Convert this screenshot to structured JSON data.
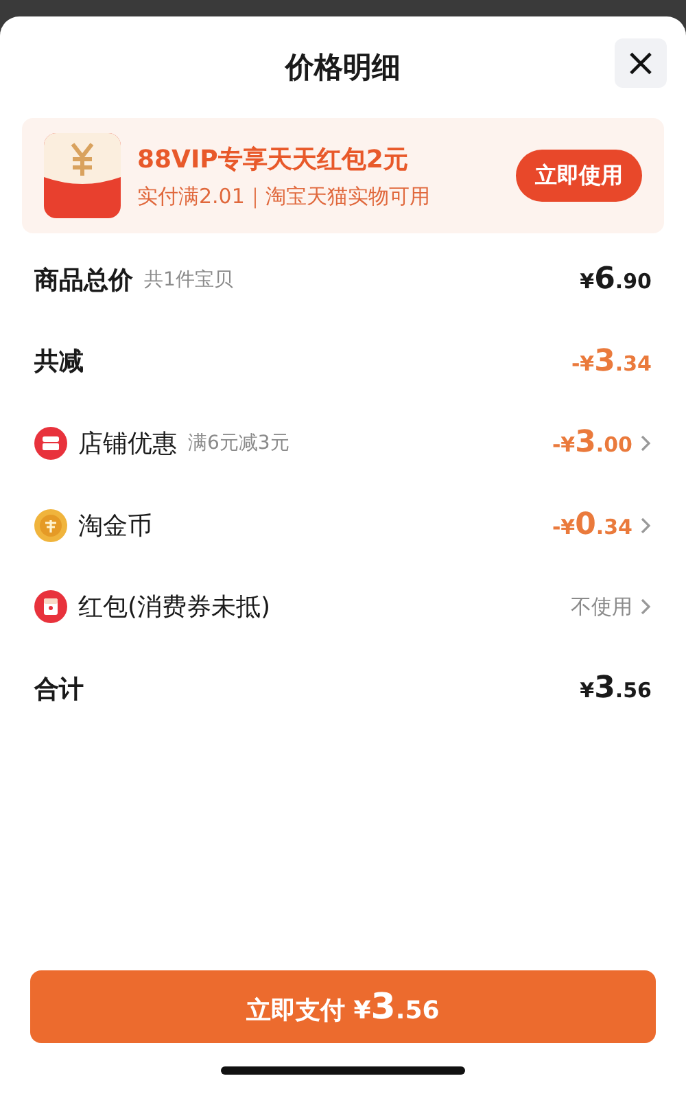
{
  "sheet": {
    "title": "价格明细",
    "close": "×"
  },
  "promo": {
    "title": "88VIP专享天天红包2元",
    "subtitle": "实付满2.01｜淘宝天猫实物可用",
    "button": "立即使用"
  },
  "rows": [
    {
      "kind": "subtotal",
      "label": "商品总价",
      "note": "共1件宝贝",
      "price": {
        "sign": "¥",
        "whole": "6",
        "fraction": ".90"
      }
    },
    {
      "kind": "discount",
      "label": "共减",
      "price": {
        "sign": "-¥",
        "whole": "3",
        "fraction": ".34"
      }
    },
    {
      "kind": "shop",
      "label": "店铺优惠",
      "note": "满6元减3元",
      "price": {
        "sign": "-¥",
        "whole": "3",
        "fraction": ".00"
      }
    },
    {
      "kind": "coin",
      "label": "淘金币",
      "price": {
        "sign": "-¥",
        "whole": "0",
        "fraction": ".34"
      }
    },
    {
      "kind": "packet",
      "label": "红包(消费券未抵)",
      "value": "不使用"
    },
    {
      "kind": "total",
      "label": "合计",
      "price": {
        "sign": "¥",
        "whole": "3",
        "fraction": ".56"
      }
    }
  ],
  "pay_button": {
    "label": "立即支付",
    "price": {
      "sign": "¥",
      "whole": "3",
      "fraction": ".56"
    }
  }
}
